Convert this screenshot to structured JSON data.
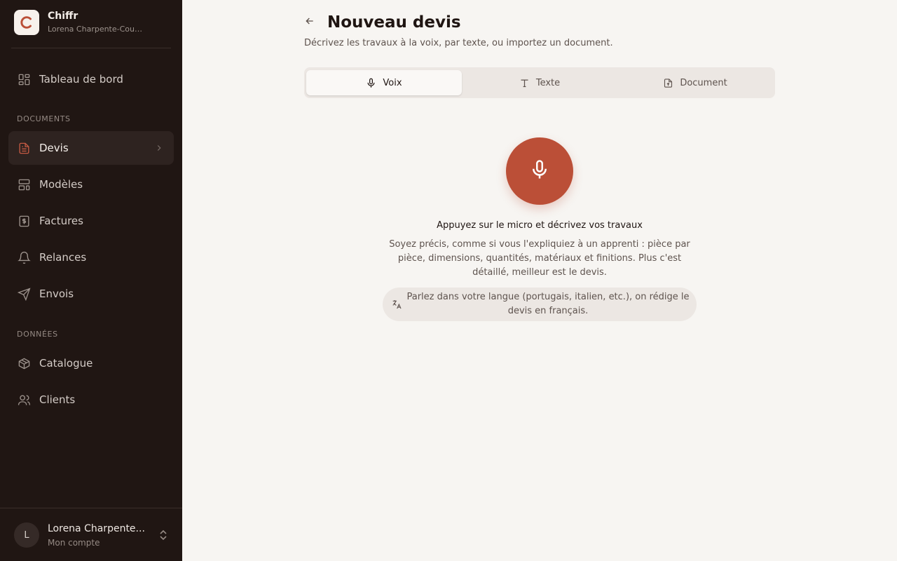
{
  "app": {
    "name": "Chiffr",
    "workspace": "Lorena Charpente-Couve..."
  },
  "sidebar": {
    "top_item": {
      "label": "Tableau de bord",
      "icon": "dashboard-icon"
    },
    "sections": [
      {
        "label": "DOCUMENTS",
        "items": [
          {
            "label": "Devis",
            "icon": "file-text-icon",
            "active": true
          },
          {
            "label": "Modèles",
            "icon": "template-icon"
          },
          {
            "label": "Factures",
            "icon": "invoice-icon"
          },
          {
            "label": "Relances",
            "icon": "bell-icon"
          },
          {
            "label": "Envois",
            "icon": "send-icon"
          }
        ]
      },
      {
        "label": "DONNÉES",
        "items": [
          {
            "label": "Catalogue",
            "icon": "box-icon"
          },
          {
            "label": "Clients",
            "icon": "users-icon"
          }
        ]
      }
    ],
    "user": {
      "initial": "L",
      "name": "Lorena Charpente...",
      "sub": "Mon compte"
    }
  },
  "main": {
    "title": "Nouveau devis",
    "subtitle": "Décrivez les travaux à la voix, par texte, ou importez un document.",
    "tabs": [
      {
        "label": "Voix",
        "icon": "mic-icon",
        "active": true
      },
      {
        "label": "Texte",
        "icon": "text-icon"
      },
      {
        "label": "Document",
        "icon": "file-upload-icon"
      }
    ],
    "voice": {
      "prompt_title": "Appuyez sur le micro et décrivez vos travaux",
      "prompt_desc": "Soyez précis, comme si vous l'expliquiez à un apprenti : pièce par pièce, dimensions, quantités, matériaux et finitions. Plus c'est détaillé, meilleur est le devis.",
      "language_note": "Parlez dans votre langue (portugais, italien, etc.), on rédige le devis en français."
    }
  },
  "colors": {
    "sidebar_bg": "#201613",
    "accent": "#bb4f37",
    "page_bg": "#f7f5f2"
  }
}
